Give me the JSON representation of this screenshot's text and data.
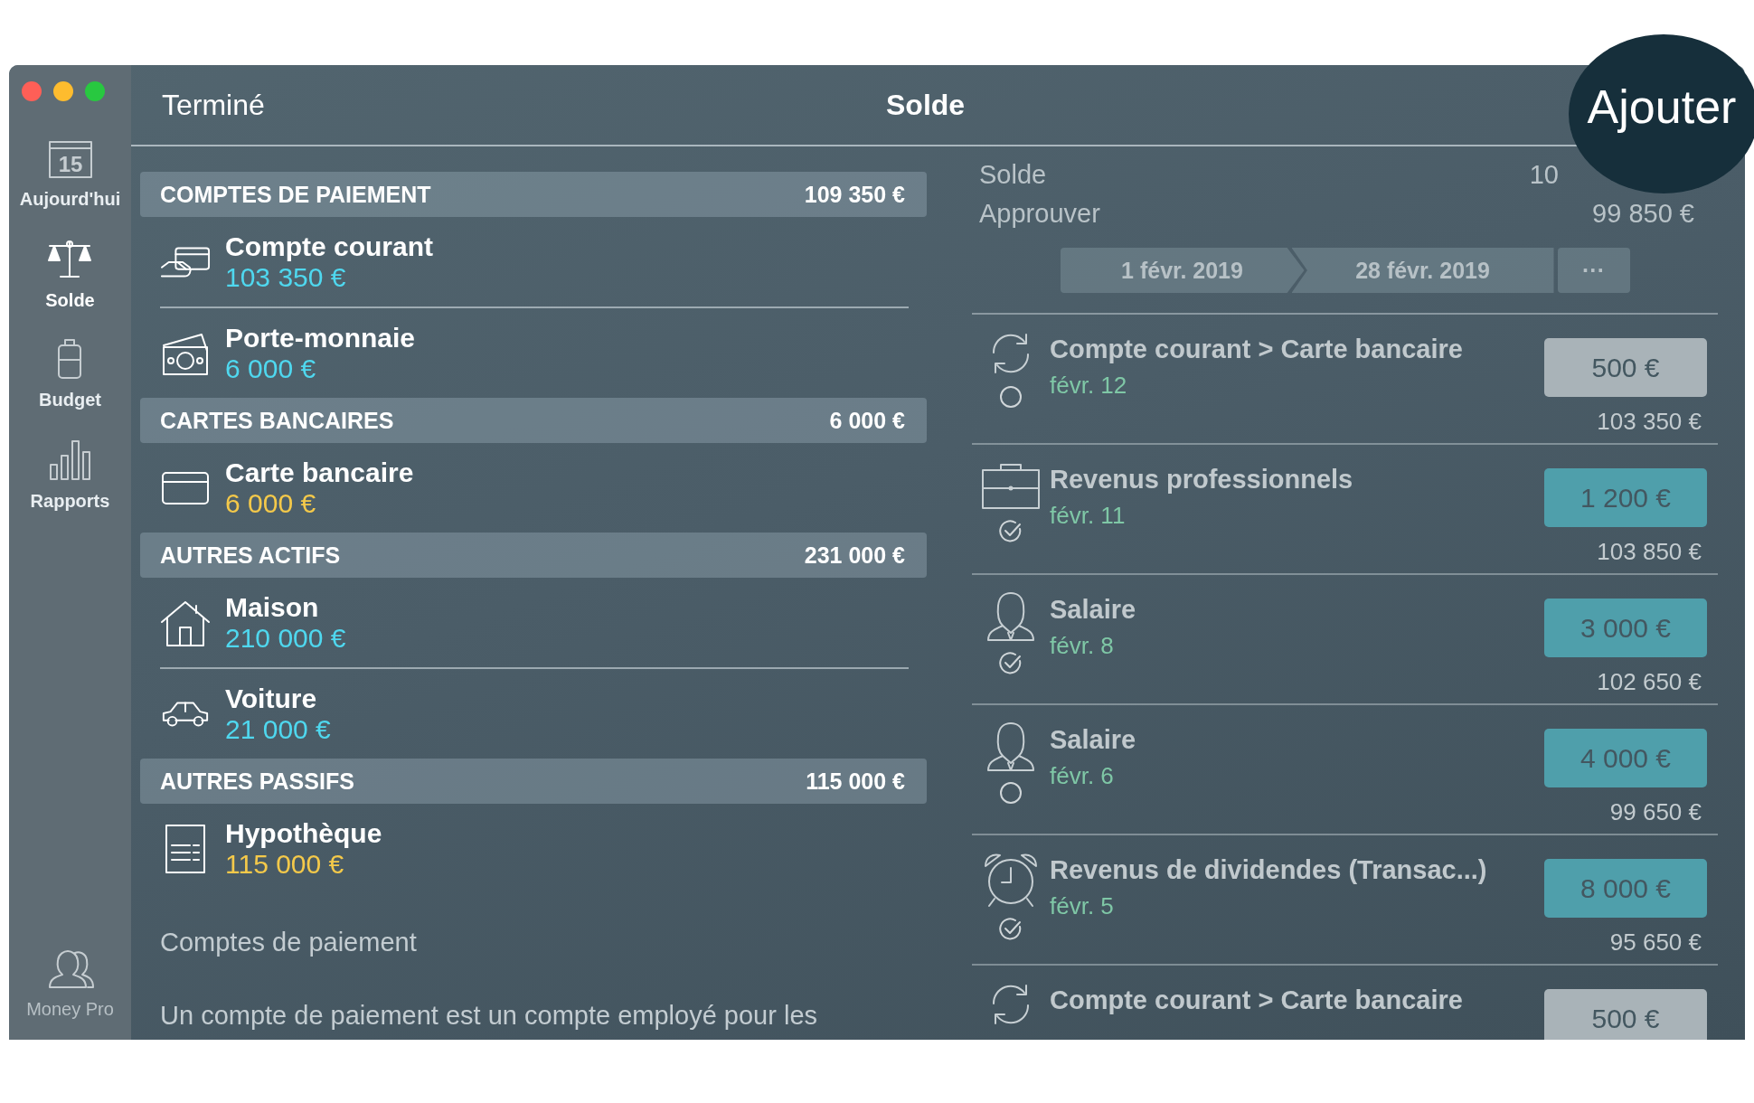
{
  "sidebar": {
    "items": [
      {
        "label": "Aujourd'hui",
        "icon_text": "15",
        "selected": false
      },
      {
        "label": "Solde",
        "selected": true
      },
      {
        "label": "Budget",
        "selected": false
      },
      {
        "label": "Rapports",
        "selected": false
      }
    ],
    "footer": {
      "label": "Money Pro"
    }
  },
  "toolbar": {
    "done": "Terminé",
    "title": "Solde",
    "add": "Ajouter"
  },
  "accounts": {
    "groups": [
      {
        "title": "COMPTES DE PAIEMENT",
        "total": "109 350 €",
        "items": [
          {
            "name": "Compte courant",
            "amount": "103 350 €",
            "color": "#4fd8ef"
          },
          {
            "name": "Porte-monnaie",
            "amount": "6 000 €",
            "color": "#4fd8ef"
          }
        ]
      },
      {
        "title": "CARTES BANCAIRES",
        "total": "6 000 €",
        "items": [
          {
            "name": "Carte bancaire",
            "amount": "6 000 €",
            "color": "#f4c94a"
          }
        ]
      },
      {
        "title": "AUTRES ACTIFS",
        "total": "231 000 €",
        "items": [
          {
            "name": "Maison",
            "amount": "210 000 €",
            "color": "#4fd8ef"
          },
          {
            "name": "Voiture",
            "amount": "21 000 €",
            "color": "#4fd8ef"
          }
        ]
      },
      {
        "title": "AUTRES PASSIFS",
        "total": "115 000 €",
        "items": [
          {
            "name": "Hypothèque",
            "amount": "115 000 €",
            "color": "#f4c94a"
          }
        ]
      }
    ],
    "info": {
      "heading": "Comptes de paiement",
      "text": "Un compte de paiement est un compte employé pour les"
    }
  },
  "summary": {
    "rows": [
      {
        "label": "Solde",
        "value": "10"
      },
      {
        "label": "Approuver",
        "value": "99 850 €"
      }
    ],
    "period": {
      "start": "1 févr. 2019",
      "end": "28 févr. 2019",
      "more": "···"
    }
  },
  "transactions": [
    {
      "kind": "transfer",
      "title": "Compte courant > Carte bancaire",
      "date": "févr. 12",
      "amount": "500 €",
      "balance": "103 350 €",
      "cleared": false
    },
    {
      "kind": "business",
      "title": "Revenus professionnels",
      "date": "févr. 11",
      "amount": "1 200 €",
      "balance": "103 850 €",
      "cleared": true
    },
    {
      "kind": "salary",
      "title": "Salaire",
      "date": "févr. 8",
      "amount": "3 000 €",
      "balance": "102 650 €",
      "cleared": true
    },
    {
      "kind": "salary",
      "title": "Salaire",
      "date": "févr. 6",
      "amount": "4 000 €",
      "balance": "99 650 €",
      "cleared": false
    },
    {
      "kind": "dividend",
      "title": "Revenus de dividendes (Transac...)",
      "date": "févr. 5",
      "amount": "8 000 €",
      "balance": "95 650 €",
      "cleared": true
    },
    {
      "kind": "transfer",
      "title": "Compte courant > Carte bancaire",
      "amount": "500 €"
    }
  ]
}
